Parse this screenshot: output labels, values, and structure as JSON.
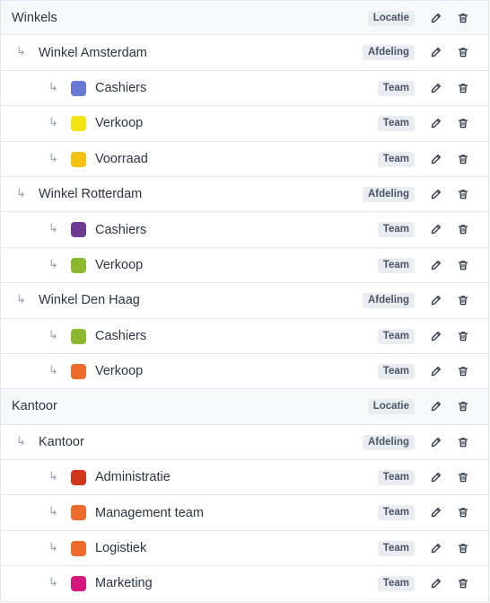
{
  "badges": {
    "location": "Locatie",
    "department": "Afdeling",
    "team": "Team"
  },
  "rows": [
    {
      "level": "location",
      "label": "Winkels"
    },
    {
      "level": "department",
      "label": "Winkel Amsterdam"
    },
    {
      "level": "team",
      "label": "Cashiers",
      "color": "#6878d4"
    },
    {
      "level": "team",
      "label": "Verkoop",
      "color": "#f1e40f"
    },
    {
      "level": "team",
      "label": "Voorraad",
      "color": "#f5c211"
    },
    {
      "level": "department",
      "label": "Winkel Rotterdam"
    },
    {
      "level": "team",
      "label": "Cashiers",
      "color": "#6e3a93"
    },
    {
      "level": "team",
      "label": "Verkoop",
      "color": "#8ab92d"
    },
    {
      "level": "department",
      "label": "Winkel Den Haag"
    },
    {
      "level": "team",
      "label": "Cashiers",
      "color": "#8ab92d"
    },
    {
      "level": "team",
      "label": "Verkoop",
      "color": "#ee6b2b"
    },
    {
      "level": "location",
      "label": "Kantoor"
    },
    {
      "level": "department",
      "label": "Kantoor"
    },
    {
      "level": "team",
      "label": "Administratie",
      "color": "#d2361a"
    },
    {
      "level": "team",
      "label": "Management team",
      "color": "#ee6b2b"
    },
    {
      "level": "team",
      "label": "Logistiek",
      "color": "#ee6b2b"
    },
    {
      "level": "team",
      "label": "Marketing",
      "color": "#d4167e"
    }
  ]
}
